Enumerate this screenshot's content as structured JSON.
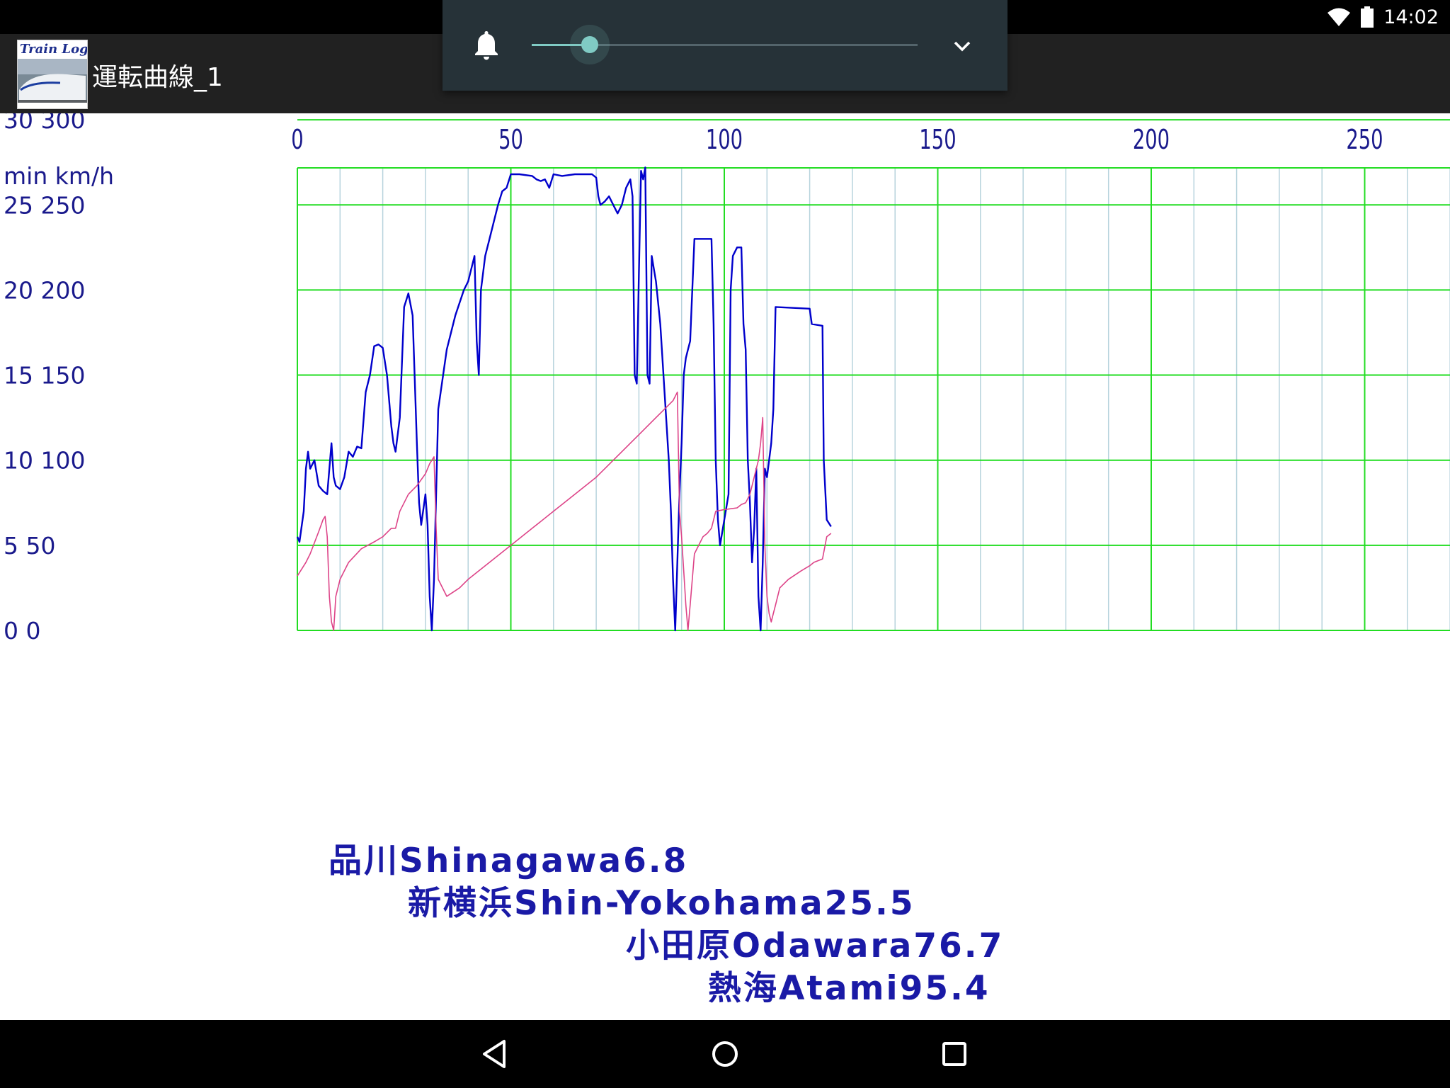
{
  "status_bar": {
    "time": "14:02",
    "icons": [
      "wifi-icon",
      "battery-icon"
    ]
  },
  "app_bar": {
    "logo_text": "Train Log",
    "title": "運転曲線_1"
  },
  "volume_panel": {
    "icon": "bell-icon",
    "level": 0.15,
    "expand_icon": "chevron-down-icon"
  },
  "colors": {
    "grid": "#22dd22",
    "minor_grid": "#b7d3dd",
    "speed_line": "#0000cc",
    "time_line": "#dd4488",
    "axis_text": "#1a1a8c",
    "station_text": "#1a1aa6"
  },
  "chart_data": {
    "type": "line",
    "x_ticks": [
      0,
      50,
      100,
      150,
      200,
      250
    ],
    "xlim": [
      0,
      270
    ],
    "y_header": "min km/h",
    "y_tick_labels": [
      {
        "label": "30 300",
        "v": 300
      },
      {
        "label": "25 250",
        "v": 250
      },
      {
        "label": "20 200",
        "v": 200
      },
      {
        "label": "15 150",
        "v": 150
      },
      {
        "label": "10 100",
        "v": 100
      },
      {
        "label": " 5  50",
        "v": 50
      },
      {
        "label": " 0   0",
        "v": 0
      }
    ],
    "ylim": [
      0,
      338
    ],
    "grid": true,
    "series": [
      {
        "unit": "km/h",
        "color": "#0000cc",
        "points": [
          [
            0,
            55
          ],
          [
            0.5,
            52
          ],
          [
            1.5,
            70
          ],
          [
            2,
            95
          ],
          [
            2.5,
            105
          ],
          [
            3,
            95
          ],
          [
            4,
            100
          ],
          [
            5,
            85
          ],
          [
            6,
            82
          ],
          [
            7,
            80
          ],
          [
            7.5,
            95
          ],
          [
            8,
            110
          ],
          [
            8.5,
            90
          ],
          [
            9,
            85
          ],
          [
            10,
            83
          ],
          [
            11,
            90
          ],
          [
            12,
            105
          ],
          [
            13,
            102
          ],
          [
            14,
            108
          ],
          [
            15,
            107
          ],
          [
            16,
            140
          ],
          [
            17,
            150
          ],
          [
            18,
            167
          ],
          [
            19,
            168
          ],
          [
            20,
            166
          ],
          [
            21,
            150
          ],
          [
            22,
            120
          ],
          [
            22.5,
            110
          ],
          [
            23,
            105
          ],
          [
            24,
            125
          ],
          [
            25,
            190
          ],
          [
            26,
            198
          ],
          [
            27,
            185
          ],
          [
            28,
            110
          ],
          [
            28.5,
            75
          ],
          [
            29,
            62
          ],
          [
            30,
            80
          ],
          [
            30.5,
            62
          ],
          [
            31,
            20
          ],
          [
            31.5,
            0
          ],
          [
            32,
            30
          ],
          [
            33,
            130
          ],
          [
            35,
            165
          ],
          [
            37,
            185
          ],
          [
            39,
            200
          ],
          [
            40,
            205
          ],
          [
            41,
            215
          ],
          [
            41.5,
            220
          ],
          [
            42,
            170
          ],
          [
            42.5,
            150
          ],
          [
            43,
            200
          ],
          [
            44,
            220
          ],
          [
            45,
            230
          ],
          [
            46,
            240
          ],
          [
            47,
            250
          ],
          [
            48,
            258
          ],
          [
            49,
            260
          ],
          [
            50,
            268
          ],
          [
            52,
            268
          ],
          [
            55,
            267
          ],
          [
            56,
            265
          ],
          [
            57,
            264
          ],
          [
            58,
            265
          ],
          [
            59,
            260
          ],
          [
            60,
            268
          ],
          [
            62,
            267
          ],
          [
            65,
            268
          ],
          [
            68,
            268
          ],
          [
            69,
            268
          ],
          [
            70,
            266
          ],
          [
            70.5,
            255
          ],
          [
            71,
            250
          ],
          [
            72,
            252
          ],
          [
            73,
            255
          ],
          [
            74,
            250
          ],
          [
            75,
            245
          ],
          [
            76,
            250
          ],
          [
            77,
            260
          ],
          [
            78,
            265
          ],
          [
            78.5,
            255
          ],
          [
            79,
            150
          ],
          [
            79.5,
            145
          ],
          [
            80,
            210
          ],
          [
            80.5,
            270
          ],
          [
            81,
            265
          ],
          [
            81.5,
            272
          ],
          [
            82,
            150
          ],
          [
            82.5,
            145
          ],
          [
            83,
            220
          ],
          [
            84,
            205
          ],
          [
            85,
            180
          ],
          [
            86,
            140
          ],
          [
            86.5,
            120
          ],
          [
            87,
            100
          ],
          [
            87.5,
            70
          ],
          [
            88,
            30
          ],
          [
            88.5,
            0
          ],
          [
            89,
            40
          ],
          [
            89.5,
            80
          ],
          [
            90,
            110
          ],
          [
            90.5,
            150
          ],
          [
            91,
            160
          ],
          [
            91.5,
            165
          ],
          [
            92,
            170
          ],
          [
            93,
            230
          ],
          [
            97,
            230
          ],
          [
            97.5,
            180
          ],
          [
            98,
            100
          ],
          [
            98.5,
            65
          ],
          [
            99,
            50
          ],
          [
            100,
            65
          ],
          [
            101,
            80
          ],
          [
            101.5,
            200
          ],
          [
            102,
            220
          ],
          [
            103,
            225
          ],
          [
            104,
            225
          ],
          [
            104.5,
            180
          ],
          [
            105,
            165
          ],
          [
            105.5,
            100
          ],
          [
            106,
            75
          ],
          [
            106.5,
            40
          ],
          [
            107,
            60
          ],
          [
            107.5,
            95
          ],
          [
            108,
            20
          ],
          [
            108.5,
            0
          ],
          [
            109,
            40
          ],
          [
            109.5,
            95
          ],
          [
            110,
            90
          ],
          [
            110.5,
            100
          ],
          [
            111,
            110
          ],
          [
            111.5,
            130
          ],
          [
            112,
            190
          ],
          [
            120,
            189
          ],
          [
            120.5,
            180
          ],
          [
            123,
            179
          ],
          [
            123.3,
            100
          ],
          [
            124,
            65
          ],
          [
            125,
            61
          ]
        ]
      },
      {
        "unit": "min",
        "color": "#dd4488",
        "points": [
          [
            0,
            32
          ],
          [
            2,
            40
          ],
          [
            3,
            45
          ],
          [
            5,
            58
          ],
          [
            6,
            65
          ],
          [
            6.5,
            67
          ],
          [
            7,
            55
          ],
          [
            7.5,
            20
          ],
          [
            8,
            5
          ],
          [
            8.5,
            0
          ],
          [
            9,
            20
          ],
          [
            10,
            30
          ],
          [
            12,
            40
          ],
          [
            15,
            48
          ],
          [
            18,
            52
          ],
          [
            20,
            55
          ],
          [
            22,
            60
          ],
          [
            23,
            60
          ],
          [
            24,
            70
          ],
          [
            26,
            80
          ],
          [
            28,
            85
          ],
          [
            30,
            92
          ],
          [
            31,
            98
          ],
          [
            32,
            102
          ],
          [
            32.5,
            60
          ],
          [
            33,
            30
          ],
          [
            35,
            20
          ],
          [
            38,
            25
          ],
          [
            40,
            30
          ],
          [
            45,
            40
          ],
          [
            50,
            50
          ],
          [
            55,
            60
          ],
          [
            60,
            70
          ],
          [
            65,
            80
          ],
          [
            70,
            90
          ],
          [
            72,
            95
          ],
          [
            74,
            100
          ],
          [
            76,
            105
          ],
          [
            78,
            110
          ],
          [
            80,
            115
          ],
          [
            82,
            120
          ],
          [
            84,
            125
          ],
          [
            86,
            130
          ],
          [
            88,
            135
          ],
          [
            89,
            140
          ],
          [
            89.5,
            70
          ],
          [
            90,
            55
          ],
          [
            90.5,
            35
          ],
          [
            91,
            15
          ],
          [
            91.5,
            0
          ],
          [
            92,
            15
          ],
          [
            93,
            45
          ],
          [
            94,
            50
          ],
          [
            95,
            55
          ],
          [
            96,
            57
          ],
          [
            97,
            60
          ],
          [
            98,
            70
          ],
          [
            100,
            71
          ],
          [
            103,
            72
          ],
          [
            104,
            74
          ],
          [
            105,
            75
          ],
          [
            106,
            80
          ],
          [
            107,
            90
          ],
          [
            108,
            100
          ],
          [
            108.5,
            110
          ],
          [
            109,
            125
          ],
          [
            109.5,
            50
          ],
          [
            110,
            20
          ],
          [
            110.5,
            10
          ],
          [
            111,
            5
          ],
          [
            111.5,
            10
          ],
          [
            112,
            15
          ],
          [
            113,
            25
          ],
          [
            115,
            30
          ],
          [
            118,
            35
          ],
          [
            120,
            38
          ],
          [
            121,
            40
          ],
          [
            123,
            42
          ],
          [
            124,
            55
          ],
          [
            125,
            57
          ]
        ]
      }
    ]
  },
  "stations": [
    {
      "label": "品川Shinagawa6.8",
      "km": 6.8
    },
    {
      "label": "新横浜Shin-Yokohama25.5",
      "km": 25.5
    },
    {
      "label": "小田原Odawara76.7",
      "km": 76.7
    },
    {
      "label": "熱海Atami95.4",
      "km": 95.4
    }
  ],
  "nav_bar": {
    "buttons": [
      "back-icon",
      "home-icon",
      "recents-icon"
    ]
  }
}
